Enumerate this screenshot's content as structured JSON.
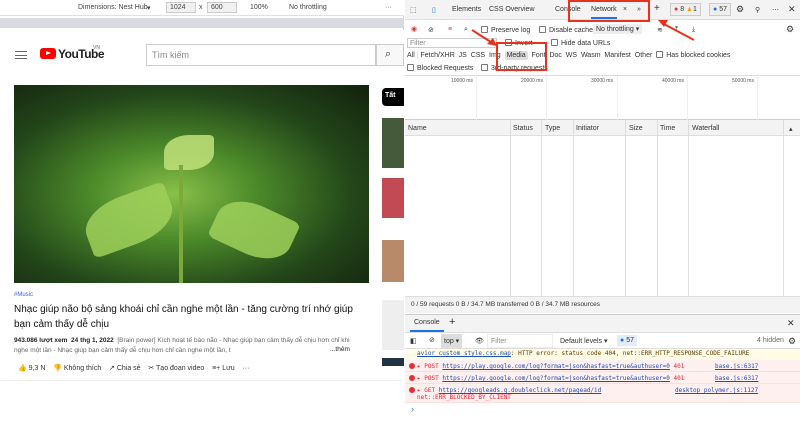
{
  "device_toolbar": {
    "dimensions": "Dimensions: Nest Hub",
    "width": "1024",
    "x": "x",
    "height": "600",
    "zoom": "100%",
    "throttling": "No throttling"
  },
  "youtube": {
    "logo": "YouTube",
    "region": "VN",
    "search_placeholder": "Tìm kiếm",
    "chip": "Tất",
    "hashtag": "#Music",
    "title": "Nhạc giúp não bộ sảng khoái chỉ cần nghe một lần - tăng cường trí nhớ giúp bạn cảm thấy dễ chịu",
    "views": "943.086 lượt xem",
    "date": "24 thg 1, 2022",
    "description": "[Brain power] Kích hoạt tế bào não - Nhạc giúp bạn cảm thấy dễ chịu hơn chỉ khi nghe một lần - Nhạc giúp bạn cảm thấy dễ chịu hơn chỉ cần nghe một lần, t",
    "more": "...thêm",
    "actions": {
      "like": "9,3 N",
      "dislike": "Không thích",
      "share": "Chia sẻ",
      "clip": "Tạo đoạn video",
      "save": "Lưu",
      "more": "···"
    }
  },
  "devtools": {
    "tabs": [
      "Elements",
      "CSS Overview",
      "Console",
      "Network"
    ],
    "active_tab": "Network",
    "errors": "8",
    "warnings": "1",
    "messages": "57",
    "toolbar": {
      "preserve_log": "Preserve log",
      "disable_cache": "Disable cache",
      "throttling": "No throttling"
    },
    "filter": {
      "placeholder": "Filter",
      "invert": "Invert",
      "hide_data_urls": "Hide data URLs"
    },
    "types": [
      "All",
      "Fetch/XHR",
      "JS",
      "CSS",
      "Img",
      "Media",
      "Font",
      "Doc",
      "WS",
      "Wasm",
      "Manifest",
      "Other"
    ],
    "active_type": "Media",
    "has_blocked_cookies": "Has blocked cookies",
    "blocked_requests": "Blocked Requests",
    "third_party": "3rd-party requests",
    "timeline": [
      "10000 ms",
      "20000 ms",
      "30000 ms",
      "40000 ms",
      "50000 ms"
    ],
    "columns": [
      "Name",
      "Status",
      "Type",
      "Initiator",
      "Size",
      "Time",
      "Waterfall"
    ],
    "status_bar": "0 / 59 requests  0 B / 34.7 MB transferred  0 B / 34.7 MB resources",
    "console": {
      "tab": "Console",
      "context": "top",
      "filter_placeholder": "Filter",
      "levels": "Default levels",
      "count": "57",
      "hidden": "4 hidden",
      "warning": {
        "link": "avior_custom_style.css.map",
        "text": ": HTTP error: status code 404, net::ERR_HTTP_RESPONSE_CODE_FAILURE"
      },
      "errors": [
        {
          "method": "POST",
          "url": "https://play.google.com/log?format=json&hasfast=true&authuser=0",
          "code": "401",
          "source": "base.js:6317"
        },
        {
          "method": "POST",
          "url": "https://play.google.com/log?format=json&hasfast=true&authuser=0",
          "code": "401",
          "source": "base.js:6317"
        },
        {
          "method": "GET",
          "url": "https://googleads.g.doubleclick.net/pagead/id",
          "code": "net::ERR_BLOCKED_BY_CLIENT",
          "source": "desktop_polymer.js:1127"
        }
      ],
      "prompt": "›"
    }
  }
}
